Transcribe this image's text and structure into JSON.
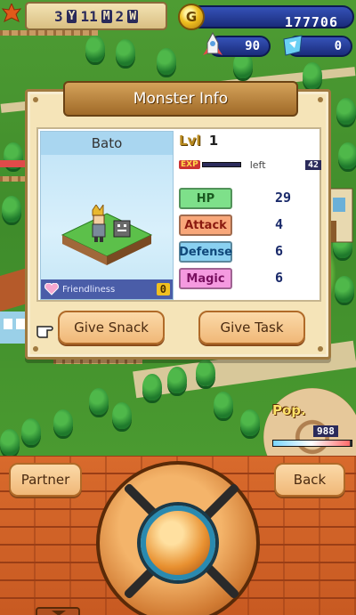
{
  "hud": {
    "date": {
      "years": "3",
      "year_unit": "Y",
      "months": "11",
      "month_unit": "M",
      "weeks": "2",
      "week_unit": "W"
    },
    "gold": {
      "icon": "coin-icon",
      "value": "177706",
      "coin_symbol": "G"
    },
    "residents": {
      "icon": "rocket-icon",
      "value": "90"
    },
    "tickets": {
      "icon": "ticket-icon",
      "value": "0"
    }
  },
  "dialog": {
    "title": "Monster Info",
    "monster": {
      "name": "Bato",
      "friendliness_label": "Friendliness",
      "friendliness_value": "0",
      "level_label": "Lvl",
      "level": "1",
      "exp_label": "EXP",
      "exp_left_label": "left",
      "exp_left_value": "42",
      "stats": [
        {
          "label": "HP",
          "value": "29",
          "color": "#7ee08a"
        },
        {
          "label": "Attack",
          "value": "4",
          "color": "#f8a77a"
        },
        {
          "label": "Defense",
          "value": "6",
          "color": "#8ad0f0"
        },
        {
          "label": "Magic",
          "value": "6",
          "color": "#f59ae0"
        }
      ]
    },
    "buttons": {
      "give_snack": "Give Snack",
      "give_task": "Give Task"
    }
  },
  "popularity": {
    "label": "Pop.",
    "value": "988",
    "level_fraction": 0.98
  },
  "controls": {
    "partner": "Partner",
    "back": "Back"
  }
}
